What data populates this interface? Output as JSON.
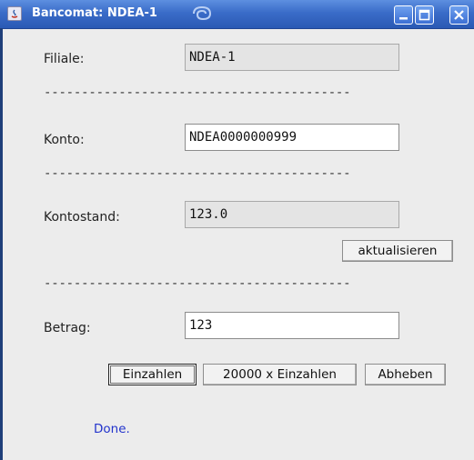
{
  "window": {
    "title": "Bancomat: NDEA-1",
    "icons": [
      "java-app-icon",
      "swirl-icon",
      "minimize-icon",
      "maximize-icon",
      "close-icon"
    ]
  },
  "form": {
    "filiale": {
      "label": "Filiale:",
      "value": "NDEA-1"
    },
    "konto": {
      "label": "Konto:",
      "value": "NDEA0000000999"
    },
    "kontostand": {
      "label": "Kontostand:",
      "value": "123.0"
    },
    "betrag": {
      "label": "Betrag:",
      "value": "123"
    },
    "separator": "-----------------------------------------"
  },
  "buttons": {
    "refresh": "aktualisieren",
    "deposit": "Einzahlen",
    "bulk_deposit": "20000 x Einzahlen",
    "withdraw": "Abheben"
  },
  "status": {
    "text": "Done."
  },
  "colors": {
    "titlebar": "#3a6cc8",
    "window_bg": "#ececec",
    "status_text": "#2233cc"
  }
}
